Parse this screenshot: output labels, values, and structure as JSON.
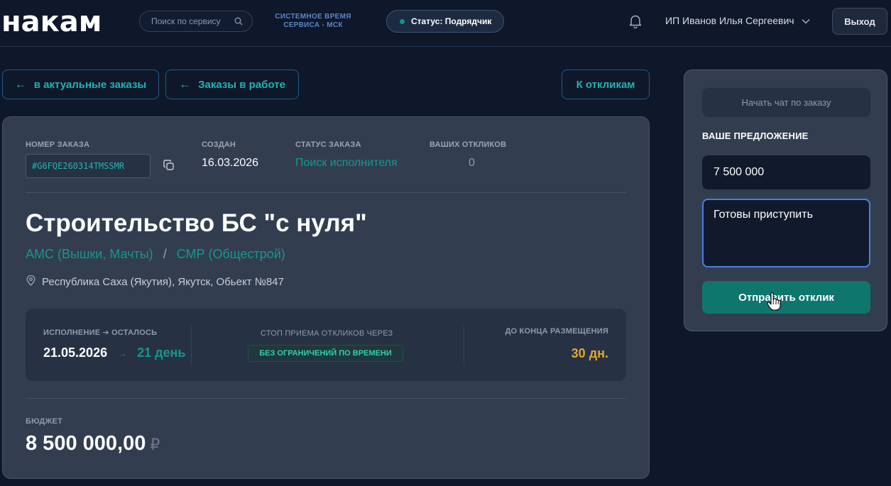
{
  "header": {
    "logo": "накам",
    "search_placeholder": "Поиск по сервису",
    "system_time_line1": "СИСТЕМНОЕ ВРЕМЯ",
    "system_time_line2": "СЕРВИСА - МСК",
    "status_label": "Статус: Подрядчик",
    "user_name": "ИП Иванов Илья Сергеевич",
    "logout_label": "Выход"
  },
  "nav": {
    "to_actual": "в актуальные заказы",
    "to_in_work": "Заказы в работе",
    "to_responses": "К откликам",
    "arrow": "←"
  },
  "order": {
    "number_label": "НОМЕР ЗАКАЗА",
    "number": "#G6FQE260314TMSSMR",
    "created_label": "СОЗДАН",
    "created": "16.03.2026",
    "status_label": "СТАТУС ЗАКАЗА",
    "status": "Поиск исполнителя",
    "responses_label": "ВАШИХ ОТКЛИКОВ",
    "responses": "0",
    "title": "Строительство БС \"с нуля\"",
    "category1": "АМС (Вышки, Мачты)",
    "category_sep": "/",
    "category2": "СМР (Общестрой)",
    "location": "Республика Саха (Якутия), Якутск, Обьект №847",
    "execution_label": "ИСПОЛНЕНИЕ ➔ ОСТАЛОСЬ",
    "execution_date": "21.05.2026",
    "execution_arrow": "→",
    "remaining": "21 день",
    "stop_label": "СТОП ПРИЕМА ОТКЛИКОВ ЧЕРЕЗ",
    "stop_value": "БЕЗ ОГРАНИЧЕНИЙ ПО ВРЕМЕНИ",
    "placement_label": "ДО КОНЦА РАЗМЕЩЕНИЯ",
    "placement_value": "30 дн.",
    "budget_label": "БЮДЖЕТ",
    "budget": "8 500 000,00",
    "currency": "₽"
  },
  "offer": {
    "chat_button": "Начать чат по заказу",
    "label": "ВАШЕ ПРЕДЛОЖЕНИЕ",
    "price": "7 500 000",
    "comment": "Готовы приступить",
    "submit": "Отправить отклик"
  },
  "colors": {
    "background": "#0f172a",
    "accent_teal": "#15968f",
    "submit_button": "#0f766e",
    "placement_value": "#e0a82e",
    "focus_border": "#4a7fe0"
  }
}
